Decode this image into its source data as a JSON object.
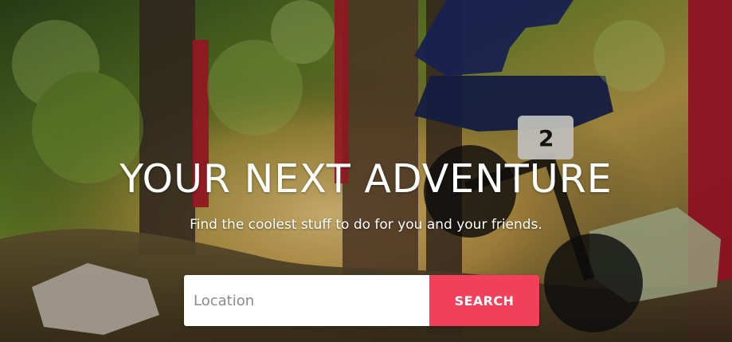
{
  "hero": {
    "title": "YOUR NEXT ADVENTURE",
    "subtitle": "Find the coolest stuff to do for you and your friends.",
    "image_alt": "Mountain biker riding a forest downhill trail"
  },
  "search": {
    "placeholder": "Location",
    "button_label": "SEARCH"
  },
  "colors": {
    "accent": "#f2405b",
    "text": "#ffffff"
  }
}
